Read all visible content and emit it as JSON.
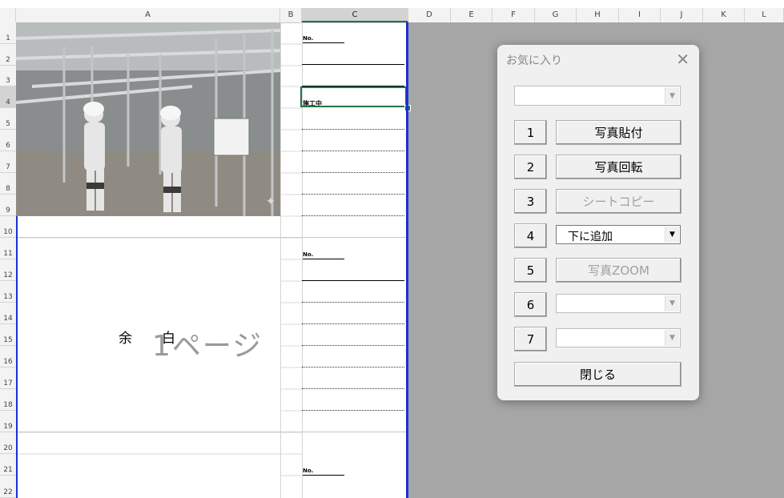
{
  "columns": [
    "A",
    "B",
    "C",
    "D",
    "E",
    "F",
    "G",
    "H",
    "I",
    "J",
    "K",
    "L"
  ],
  "rows": [
    "1",
    "2",
    "3",
    "4",
    "5",
    "6",
    "7",
    "8",
    "9",
    "10",
    "11",
    "12",
    "13",
    "14",
    "15",
    "16",
    "17",
    "18",
    "19",
    "20",
    "21",
    "22"
  ],
  "sheet": {
    "no_label": "No.",
    "status_label": "施工中",
    "yohaku_1": "余",
    "yohaku_2": "白",
    "page_watermark": "1ページ"
  },
  "photo": {
    "description_icon": "construction-photo"
  },
  "dialog": {
    "title": "お気に入り",
    "close_glyph": "✕",
    "top_combo_value": "",
    "buttons": [
      {
        "num": "1",
        "label": "写真貼付",
        "enabled": true
      },
      {
        "num": "2",
        "label": "写真回転",
        "enabled": true
      },
      {
        "num": "3",
        "label": "シートコピー",
        "enabled": false
      },
      {
        "num": "4",
        "label": "下に追加",
        "type": "combo"
      },
      {
        "num": "5",
        "label": "写真ZOOM",
        "enabled": false
      },
      {
        "num": "6",
        "label": "",
        "type": "combo"
      },
      {
        "num": "7",
        "label": "",
        "type": "combo"
      }
    ],
    "close_button_label": "閉じる"
  },
  "colors": {
    "selection_green": "#217346",
    "print_border_blue": "#1b2fd4",
    "outside_grey": "#a6a6a6"
  }
}
